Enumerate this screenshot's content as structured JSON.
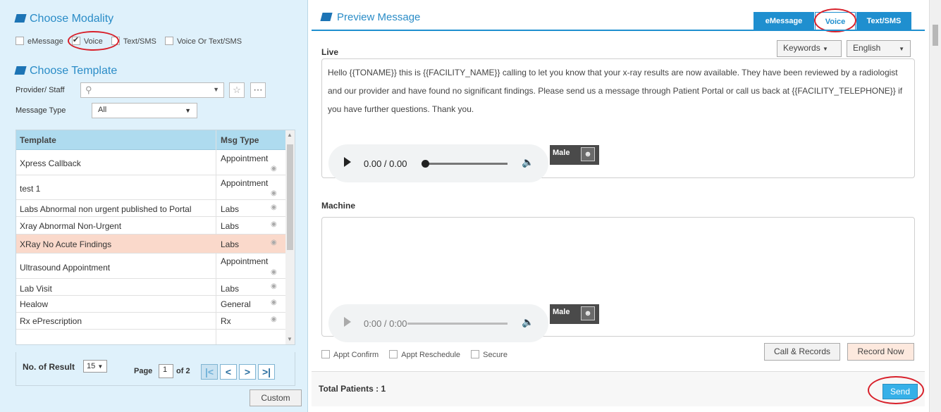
{
  "left": {
    "modality_title": "Choose Modality",
    "modalities": [
      {
        "label": "eMessage",
        "checked": false
      },
      {
        "label": "Voice",
        "checked": true
      },
      {
        "label": "Text/SMS",
        "checked": false
      },
      {
        "label": "Voice Or Text/SMS",
        "checked": false
      }
    ],
    "template_title": "Choose Template",
    "provider_label": "Provider/ Staff",
    "provider_value": "",
    "message_type_label": "Message Type",
    "message_type_value": "All",
    "table": {
      "headers": {
        "template": "Template",
        "msg_type": "Msg Type"
      },
      "rows": [
        {
          "template": "Xpress Callback",
          "msg_type": "Appointment",
          "selected": false
        },
        {
          "template": "test 1",
          "msg_type": "Appointment",
          "selected": false
        },
        {
          "template": "Labs Abnormal non urgent published to Portal",
          "msg_type": "Labs",
          "selected": false
        },
        {
          "template": "Xray Abnormal Non-Urgent",
          "msg_type": "Labs",
          "selected": false
        },
        {
          "template": "XRay No Acute Findings",
          "msg_type": "Labs",
          "selected": true
        },
        {
          "template": "Ultrasound Appointment",
          "msg_type": "Appointment",
          "selected": false
        },
        {
          "template": "Lab Visit",
          "msg_type": "Labs",
          "selected": false
        },
        {
          "template": "Healow",
          "msg_type": "General",
          "selected": false
        },
        {
          "template": "Rx ePrescription",
          "msg_type": "Rx",
          "selected": false
        }
      ]
    },
    "footer": {
      "results_label": "No. of Result",
      "results_value": "15",
      "page_label": "Page",
      "page_value": "1",
      "of_label": "of 2"
    },
    "custom_label": "Custom"
  },
  "right": {
    "preview_title": "Preview Message",
    "tabs": [
      {
        "label": "eMessage",
        "active": false
      },
      {
        "label": "Voice",
        "active": true
      },
      {
        "label": "Text/SMS",
        "active": false
      }
    ],
    "live_label": "Live",
    "keywords_label": "Keywords",
    "language_value": "English",
    "live_message": "Hello {{TONAME}} this is {{FACILITY_NAME}} calling to let you know that your x-ray results are now available. They have been reviewed by a radiologist and our provider and have found no significant findings. Please send us a message through Patient Portal or call us back at {{FACILITY_TELEPHONE}} if you have further questions. Thank you.",
    "live_audio_time": "0.00 / 0.00",
    "live_voice": "Male",
    "machine_label": "Machine",
    "machine_message": "",
    "machine_audio_time": "0:00 / 0:00",
    "machine_voice": "Male",
    "options": [
      "Appt Confirm",
      "Appt Reschedule",
      "Secure"
    ],
    "call_records_label": "Call & Records",
    "record_now_label": "Record Now",
    "total_patients": "Total Patients : 1",
    "send_label": "Send"
  },
  "colors": {
    "accent": "#1f8fcf",
    "panel_bg": "#dff1fb",
    "selected_row": "#fad9cb",
    "annotation_red": "#d8202a"
  }
}
